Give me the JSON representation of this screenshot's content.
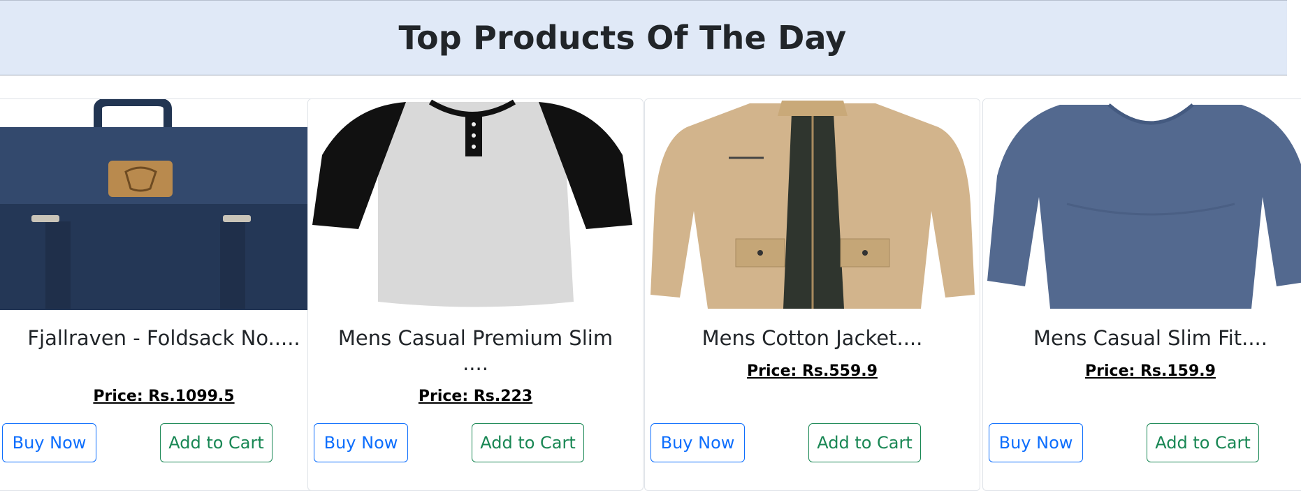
{
  "header": {
    "title": "Top Products Of The Day"
  },
  "products": [
    {
      "title": "Fjallraven - Foldsack No.....",
      "price": "Price: Rs.1099.5",
      "buy_label": "Buy Now",
      "cart_label": "Add to Cart",
      "image_icon": "backpack-image"
    },
    {
      "title": "Mens Casual Premium Slim ....",
      "price": "Price: Rs.223",
      "buy_label": "Buy Now",
      "cart_label": "Add to Cart",
      "image_icon": "raglan-tshirt-image"
    },
    {
      "title": "Mens Cotton Jacket....",
      "price": "Price: Rs.559.9",
      "buy_label": "Buy Now",
      "cart_label": "Add to Cart",
      "image_icon": "jacket-image"
    },
    {
      "title": "Mens Casual Slim Fit....",
      "price": "Price: Rs.159.9",
      "buy_label": "Buy Now",
      "cart_label": "Add to Cart",
      "image_icon": "longsleeve-shirt-image"
    }
  ],
  "colors": {
    "banner_bg": "#e0e9f7",
    "buy_button": "#0d6efd",
    "cart_button": "#198754"
  }
}
